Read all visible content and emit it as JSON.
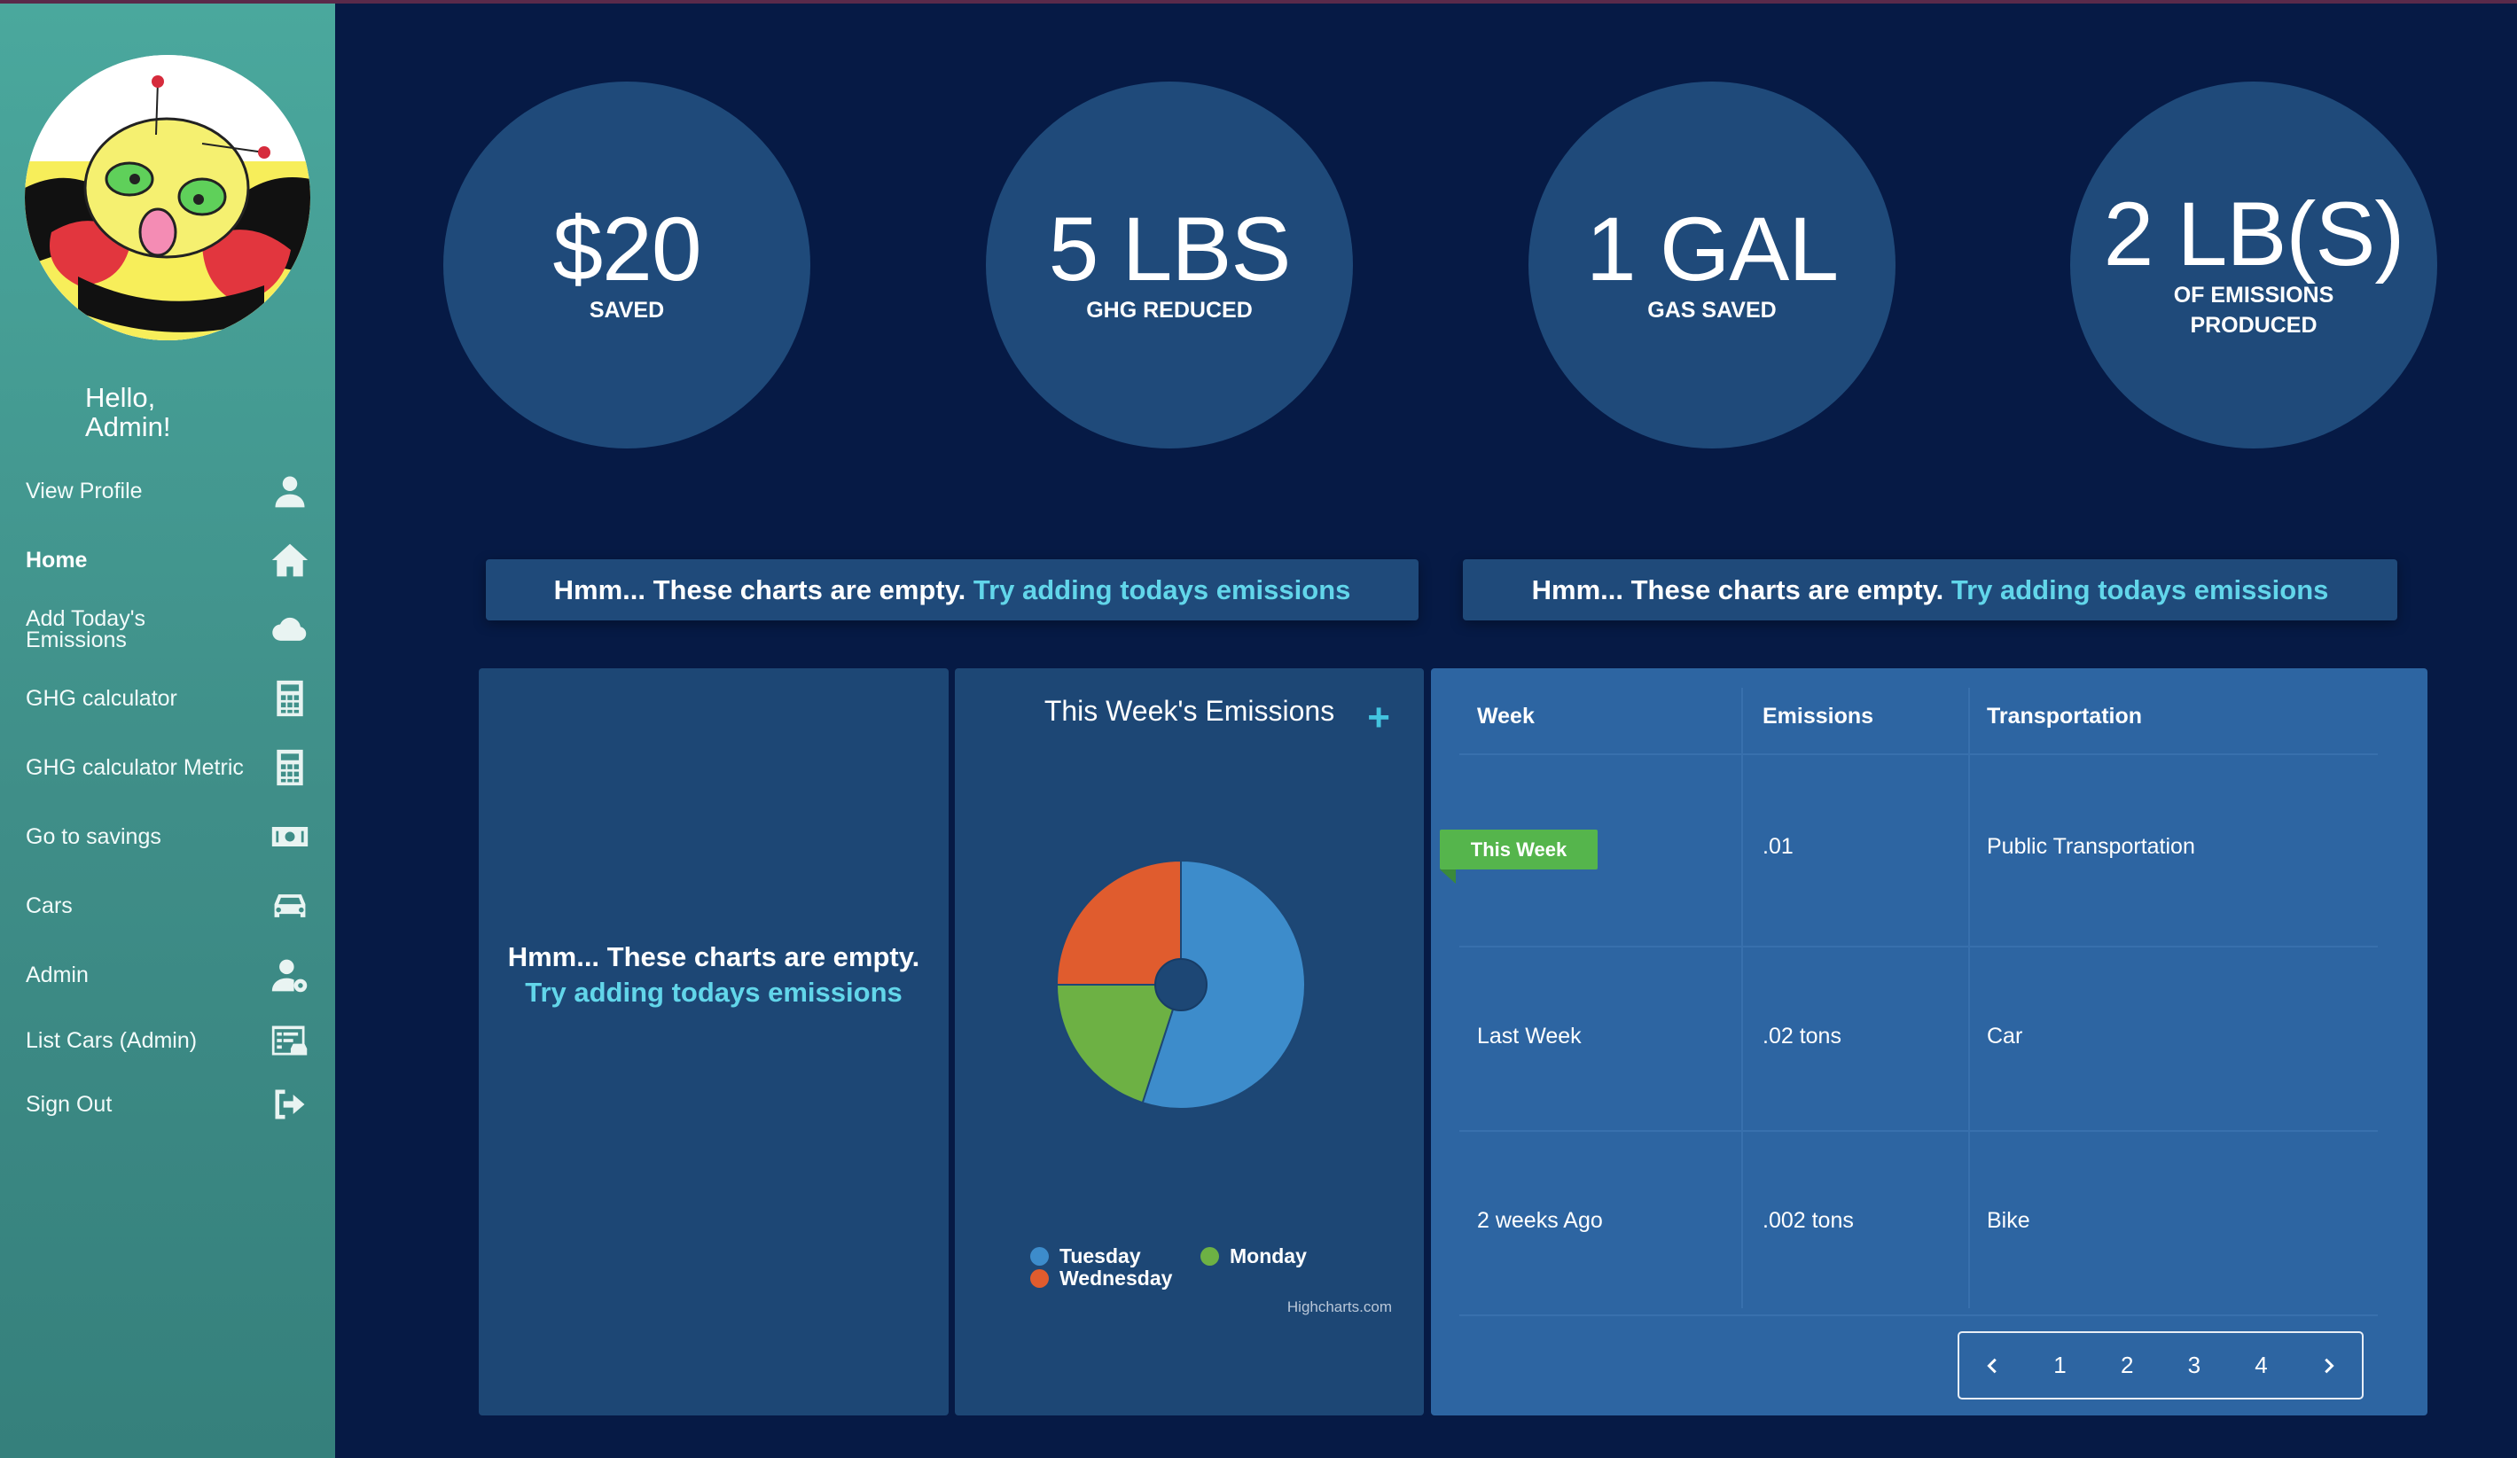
{
  "sidebar": {
    "greeting": "Hello,",
    "username": "Admin!",
    "items": [
      {
        "label": "View Profile",
        "icon": "user-icon"
      },
      {
        "label": "Home",
        "icon": "home-icon"
      },
      {
        "label": "Add Today's Emissions",
        "icon": "cloud-icon"
      },
      {
        "label": "GHG calculator",
        "icon": "calculator-icon"
      },
      {
        "label": "GHG calculator Metric",
        "icon": "calculator-icon"
      },
      {
        "label": "Go to savings",
        "icon": "money-icon"
      },
      {
        "label": "Cars",
        "icon": "car-icon"
      },
      {
        "label": "Admin",
        "icon": "user-gear-icon"
      },
      {
        "label": "List Cars (Admin)",
        "icon": "list-car-icon"
      },
      {
        "label": "Sign Out",
        "icon": "sign-out-icon"
      }
    ],
    "active": "Home"
  },
  "stats": [
    {
      "value": "$20",
      "label": "SAVED"
    },
    {
      "value": "5 LBS",
      "label": "GHG REDUCED"
    },
    {
      "value": "1 GAL",
      "label": "GAS SAVED"
    },
    {
      "value": "2 LB(S)",
      "label": "OF EMISSIONS PRODUCED"
    }
  ],
  "banners": {
    "prefix": "Hmm... These charts are empty.",
    "link": "Try adding todays emissions"
  },
  "empty_panel": {
    "prefix": "Hmm... These charts are empty.",
    "link": "Try adding todays emissions"
  },
  "pie_panel": {
    "add_symbol": "+",
    "credit": "Highcharts.com"
  },
  "chart_data": {
    "type": "pie",
    "title": "This Week's Emissions",
    "series": [
      {
        "name": "Tuesday",
        "value": 55,
        "color": "#3d8ccb"
      },
      {
        "name": "Monday",
        "value": 20,
        "color": "#6db144"
      },
      {
        "name": "Wednesday",
        "value": 25,
        "color": "#e05c2e"
      }
    ],
    "legend_position": "bottom"
  },
  "table": {
    "headers": [
      "Week",
      "Emissions",
      "Transportation"
    ],
    "highlight_tag": "This Week",
    "rows": [
      {
        "week": "",
        "emissions": ".01",
        "transportation": "Public Transportation"
      },
      {
        "week": "Last Week",
        "emissions": ".02 tons",
        "transportation": "Car"
      },
      {
        "week": "2 weeks Ago",
        "emissions": ".002 tons",
        "transportation": "Bike"
      }
    ]
  },
  "pagination": {
    "pages": [
      "1",
      "2",
      "3",
      "4"
    ]
  }
}
